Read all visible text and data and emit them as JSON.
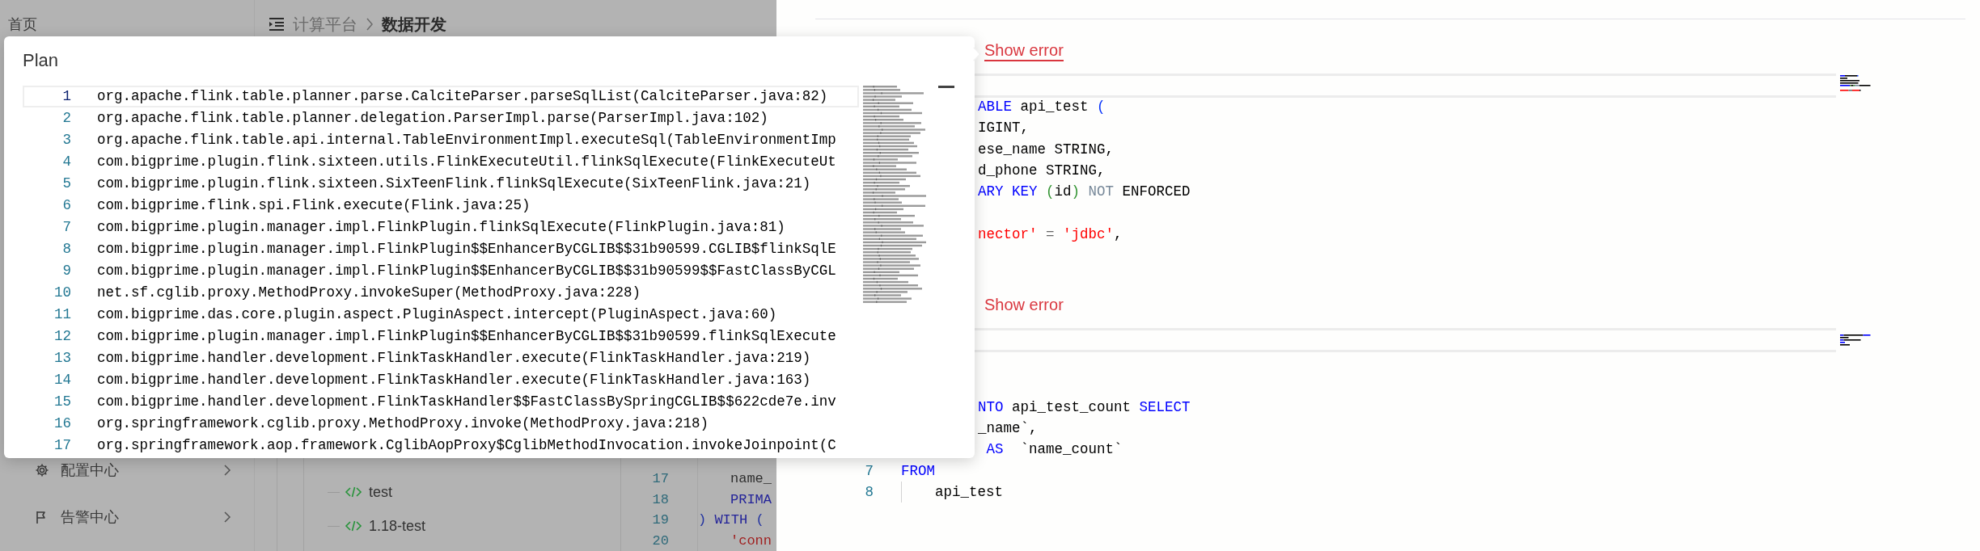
{
  "sidebar": {
    "top_item": "首页",
    "items": [
      {
        "label": "配置中心"
      },
      {
        "label": "告警中心"
      }
    ]
  },
  "breadcrumb": [
    {
      "label": "计算平台",
      "current": false
    },
    {
      "label": "数据开发",
      "current": true
    }
  ],
  "file_tree": [
    {
      "label": "test"
    },
    {
      "label": "1.18-test"
    }
  ],
  "background_editor": {
    "lines": [
      {
        "number": "17",
        "indented": true,
        "tokens": [
          {
            "text": "name_",
            "kind": "plain"
          }
        ]
      },
      {
        "number": "18",
        "indented": true,
        "tokens": [
          {
            "text": "PRIMA",
            "kind": "keyword"
          }
        ]
      },
      {
        "number": "19",
        "indented": false,
        "tokens": [
          {
            "text": ")",
            "kind": "bracket"
          },
          {
            "text": " WITH ",
            "kind": "keyword"
          },
          {
            "text": "(",
            "kind": "bracket"
          }
        ]
      },
      {
        "number": "20",
        "indented": true,
        "tokens": [
          {
            "text": "'conn",
            "kind": "string"
          }
        ]
      }
    ]
  },
  "results": [
    {
      "link": "Show error",
      "underlined": true,
      "code_lines": [
        {
          "kind": "clipped",
          "tokens": [
            {
              "text": "ABLE",
              "kind": "keyword"
            },
            {
              "text": " api_test ",
              "kind": "plain"
            },
            {
              "text": "(",
              "kind": "bracket"
            }
          ]
        },
        {
          "kind": "clipped",
          "tokens": [
            {
              "text": "IGINT,",
              "kind": "plain"
            }
          ]
        },
        {
          "kind": "clipped",
          "tokens": [
            {
              "text": "ese_name STRING,",
              "kind": "plain"
            }
          ]
        },
        {
          "kind": "clipped",
          "tokens": [
            {
              "text": "d_phone STRING,",
              "kind": "plain"
            }
          ]
        },
        {
          "kind": "clipped",
          "tokens": [
            {
              "text": "ARY KEY ",
              "kind": "keyword"
            },
            {
              "text": "(",
              "kind": "bracket2"
            },
            {
              "text": "id",
              "kind": "plain"
            },
            {
              "text": ")",
              "kind": "bracket2"
            },
            {
              "text": " NOT",
              "kind": "muted"
            },
            {
              "text": " ENFORCED",
              "kind": "plain"
            }
          ]
        },
        {
          "kind": "blank"
        },
        {
          "kind": "clipped",
          "tokens": [
            {
              "text": "nector'",
              "kind": "string"
            },
            {
              "text": " = ",
              "kind": "operator"
            },
            {
              "text": "'jdbc'",
              "kind": "string"
            },
            {
              "text": ",",
              "kind": "plain"
            }
          ]
        }
      ]
    },
    {
      "link": "Show error",
      "underlined": false,
      "code_lines": [
        {
          "kind": "blank"
        },
        {
          "kind": "blank"
        },
        {
          "kind": "clipped",
          "tokens": [
            {
              "text": "NTO",
              "kind": "keyword"
            },
            {
              "text": " api_test_count ",
              "kind": "plain"
            },
            {
              "text": "SELECT",
              "kind": "keyword"
            }
          ]
        },
        {
          "kind": "clipped",
          "tokens": [
            {
              "text": "_name`,",
              "kind": "plain"
            }
          ]
        },
        {
          "kind": "clipped",
          "tokens": [
            {
              "text": " AS",
              "kind": "keyword"
            },
            {
              "text": "  `name_count`",
              "kind": "plain"
            }
          ]
        },
        {
          "kind": "numbered",
          "number": "7",
          "indented": false,
          "tokens": [
            {
              "text": "FROM",
              "kind": "keyword"
            }
          ]
        },
        {
          "kind": "numbered",
          "number": "8",
          "indented": true,
          "tokens": [
            {
              "text": "api_test",
              "kind": "plain"
            }
          ]
        }
      ]
    }
  ],
  "plan_popup": {
    "title": "Plan",
    "lines": [
      {
        "number": "1",
        "current": true,
        "text": "org.apache.flink.table.planner.parse.CalciteParser.parseSqlList(CalciteParser.java:82)"
      },
      {
        "number": "2",
        "current": false,
        "text": "org.apache.flink.table.planner.delegation.ParserImpl.parse(ParserImpl.java:102)"
      },
      {
        "number": "3",
        "current": false,
        "text": "org.apache.flink.table.api.internal.TableEnvironmentImpl.executeSql(TableEnvironmentImp"
      },
      {
        "number": "4",
        "current": false,
        "text": "com.bigprime.plugin.flink.sixteen.utils.FlinkExecuteUtil.flinkSqlExecute(FlinkExecuteUt"
      },
      {
        "number": "5",
        "current": false,
        "text": "com.bigprime.plugin.flink.sixteen.SixTeenFlink.flinkSqlExecute(SixTeenFlink.java:21)"
      },
      {
        "number": "6",
        "current": false,
        "text": "com.bigprime.flink.spi.Flink.execute(Flink.java:25)"
      },
      {
        "number": "7",
        "current": false,
        "text": "com.bigprime.plugin.manager.impl.FlinkPlugin.flinkSqlExecute(FlinkPlugin.java:81)"
      },
      {
        "number": "8",
        "current": false,
        "text": "com.bigprime.plugin.manager.impl.FlinkPlugin$$EnhancerByCGLIB$$31b90599.CGLIB$flinkSqlE"
      },
      {
        "number": "9",
        "current": false,
        "text": "com.bigprime.plugin.manager.impl.FlinkPlugin$$EnhancerByCGLIB$$31b90599$$FastClassByCGL"
      },
      {
        "number": "10",
        "current": false,
        "text": "net.sf.cglib.proxy.MethodProxy.invokeSuper(MethodProxy.java:228)"
      },
      {
        "number": "11",
        "current": false,
        "text": "com.bigprime.das.core.plugin.aspect.PluginAspect.intercept(PluginAspect.java:60)"
      },
      {
        "number": "12",
        "current": false,
        "text": "com.bigprime.plugin.manager.impl.FlinkPlugin$$EnhancerByCGLIB$$31b90599.flinkSqlExecute"
      },
      {
        "number": "13",
        "current": false,
        "text": "com.bigprime.handler.development.FlinkTaskHandler.execute(FlinkTaskHandler.java:219)"
      },
      {
        "number": "14",
        "current": false,
        "text": "com.bigprime.handler.development.FlinkTaskHandler.execute(FlinkTaskHandler.java:163)"
      },
      {
        "number": "15",
        "current": false,
        "text": "com.bigprime.handler.development.FlinkTaskHandler$$FastClassBySpringCGLIB$$622cde7e.inv"
      },
      {
        "number": "16",
        "current": false,
        "text": "org.springframework.cglib.proxy.MethodProxy.invoke(MethodProxy.java:218)"
      },
      {
        "number": "17",
        "current": false,
        "text": "org.springframework.aop.framework.CglibAopProxy$CglibMethodInvocation.invokeJoinpoint(C"
      }
    ]
  }
}
